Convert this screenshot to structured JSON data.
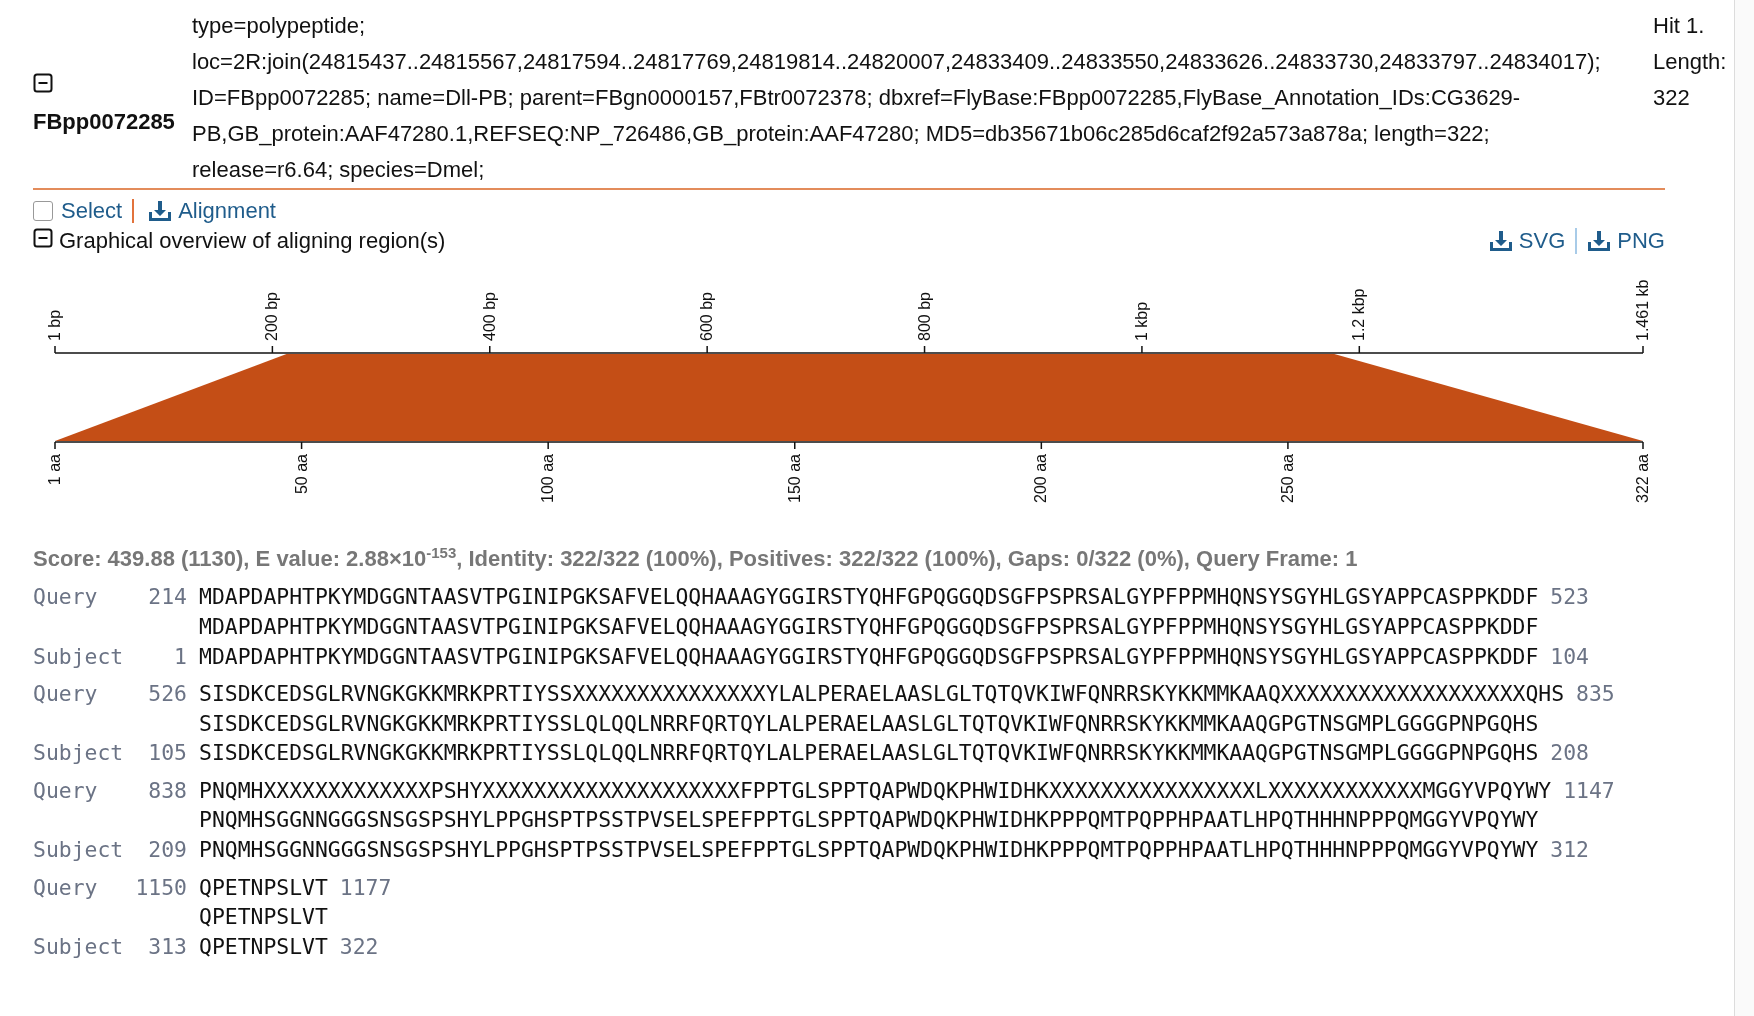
{
  "hit": {
    "id": "FBpp0072285",
    "expanded": true,
    "defline_lines": [
      "type=polypeptide;",
      "loc=2R:join(24815437..24815567,24817594..24817769,24819814..24820007,24833409..24833550,24833626..24833730,24833797..24834017);",
      "ID=FBpp0072285; name=Dll-PB; parent=FBgn0000157,FBtr0072378; dbxref=FlyBase:FBpp0072285,FlyBase_Annotation_IDs:CG3629-",
      "PB,GB_protein:AAF47280.1,REFSEQ:NP_726486,GB_protein:AAF47280; MD5=db35671b06c285d6caf2f92a573a878a; length=322;",
      "release=r6.64; species=Dmel;"
    ],
    "info_lines": [
      "Hit 1.",
      "Length:",
      "322"
    ]
  },
  "actions": {
    "select": {
      "label": "Select",
      "checked": false
    },
    "download": "Alignment"
  },
  "overview": {
    "title": "Graphical overview of aligning region(s)",
    "expanded": true,
    "downloads": [
      "SVG",
      "PNG"
    ],
    "query_ticks": [
      "1 bp",
      "200 bp",
      "400 bp",
      "600 bp",
      "800 bp",
      "1 kbp",
      "1.2 kbp",
      "1.461 kb"
    ],
    "subject_ticks": [
      "1 aa",
      "50 aa",
      "100 aa",
      "150 aa",
      "200 aa",
      "250 aa",
      "322 aa"
    ]
  },
  "score_line": "Score: 439.88 (1130), E value: 2.88×10$^{-153}$, Identity: 322/322 (100%), Positives: 322/322 (100%), Gaps: 0/322 (0%), Query Frame: 1",
  "alignment": [
    {
      "query_label": "Query",
      "query_start": "214",
      "query_seq": "MDAPDAPHTPKYMDGGNTAASVTPGINIPGKSAFVELQQHAAAGYGGIRSTYQHFGPQGGQDSGFPSPRSALGYPFPPMHQNSYSGYHLGSYAPPCASPPKDDF",
      "query_end": "523",
      "midline": "MDAPDAPHTPKYMDGGNTAASVTPGINIPGKSAFVELQQHAAAGYGGIRSTYQHFGPQGGQDSGFPSPRSALGYPFPPMHQNSYSGYHLGSYAPPCASPPKDDF",
      "subject_label": "Subject",
      "subject_start": "1",
      "subject_seq": "MDAPDAPHTPKYMDGGNTAASVTPGINIPGKSAFVELQQHAAAGYGGIRSTYQHFGPQGGQDSGFPSPRSALGYPFPPMHQNSYSGYHLGSYAPPCASPPKDDF",
      "subject_end": "104"
    },
    {
      "query_label": "Query",
      "query_start": "526",
      "query_seq": "SISDKCEDSGLRVNGKGKKMRKPRTIYSSXXXXXXXXXXXXXXXYLALPERAELAASLGLTQTQVKIWFQNRRSKYKKMMKAAQXXXXXXXXXXXXXXXXXXXQHS",
      "query_end": "835",
      "midline": "SISDKCEDSGLRVNGKGKKMRKPRTIYSSLQLQQLNRRFQRTQYLALPERAELAASLGLTQTQVKIWFQNRRSKYKKMMKAAQGPGTNSGMPLGGGGPNPGQHS",
      "subject_label": "Subject",
      "subject_start": "105",
      "subject_seq": "SISDKCEDSGLRVNGKGKKMRKPRTIYSSLQLQQLNRRFQRTQYLALPERAELAASLGLTQTQVKIWFQNRRSKYKKMMKAAQGPGTNSGMPLGGGGPNPGQHS",
      "subject_end": "208"
    },
    {
      "query_label": "Query",
      "query_start": "838",
      "query_seq": "PNQMHXXXXXXXXXXXXXPSHYXXXXXXXXXXXXXXXXXXXXFPPTGLSPPTQAPWDQKPHWIDHKXXXXXXXXXXXXXXXXLXXXXXXXXXXXXMGGYVPQYWY",
      "query_end": "1147",
      "midline": "PNQMHSGGNNGGGSNSGSPSHYLPPGHSPTPSSTPVSELSPEFPPTGLSPPTQAPWDQKPHWIDHKPPPQMTPQPPHPAATLHPQTHHHNPPPQMGGYVPQYWY",
      "subject_label": "Subject",
      "subject_start": "209",
      "subject_seq": "PNQMHSGGNNGGGSNSGSPSHYLPPGHSPTPSSTPVSELSPEFPPTGLSPPTQAPWDQKPHWIDHKPPPQMTPQPPHPAATLHPQTHHHNPPPQMGGYVPQYWY",
      "subject_end": "312"
    },
    {
      "query_label": "Query",
      "query_start": "1150",
      "query_seq": "QPETNPSLVT",
      "query_end": "1177",
      "midline": "QPETNPSLVT",
      "subject_label": "Subject",
      "subject_start": "313",
      "subject_seq": "QPETNPSLVT",
      "subject_end": "322"
    }
  ]
}
